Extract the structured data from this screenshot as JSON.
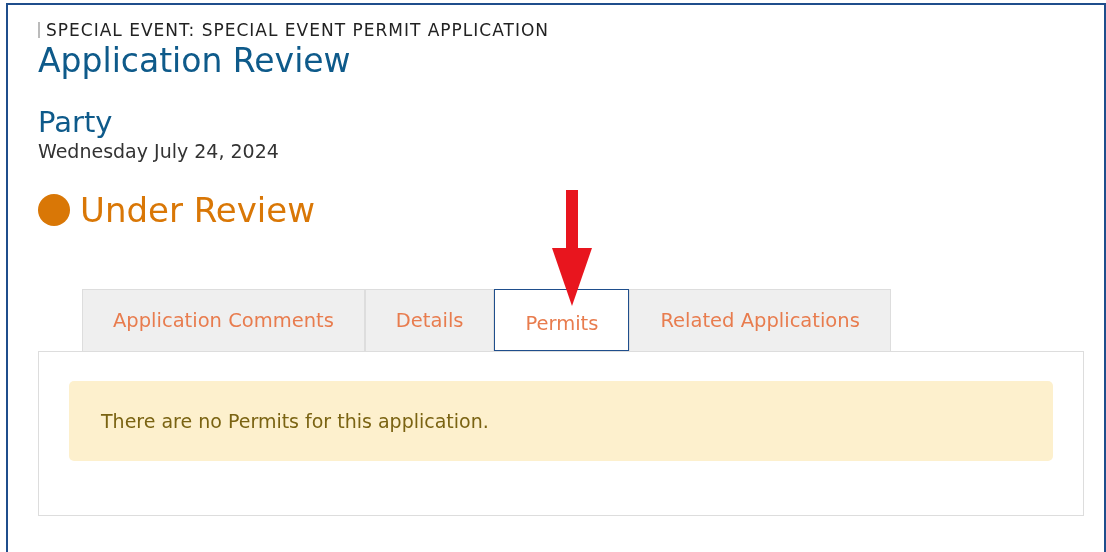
{
  "header": {
    "breadcrumb": "SPECIAL EVENT: SPECIAL EVENT PERMIT APPLICATION",
    "title": "Application Review"
  },
  "event": {
    "name": "Party",
    "date": "Wednesday July 24, 2024"
  },
  "status": {
    "label": "Under Review",
    "color": "#d97706"
  },
  "tabs": [
    {
      "label": "Application Comments",
      "selected": false
    },
    {
      "label": "Details",
      "selected": false
    },
    {
      "label": "Permits",
      "selected": true
    },
    {
      "label": "Related Applications",
      "selected": false
    }
  ],
  "alert": {
    "message": "There are no Permits for this application."
  }
}
